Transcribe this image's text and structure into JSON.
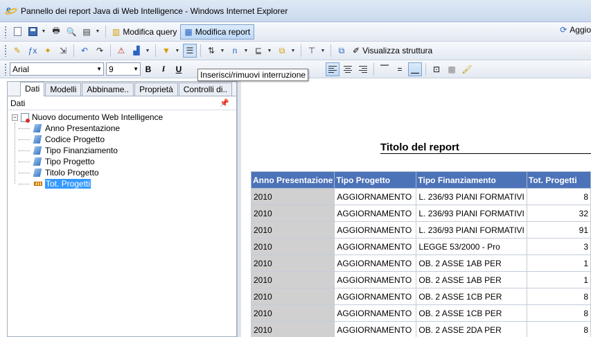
{
  "window": {
    "title": "Pannello dei report Java di Web Intelligence - Windows Internet Explorer"
  },
  "toolbar1": {
    "modifica_query": "Modifica query",
    "modifica_report": "Modifica report",
    "right_label": "Aggio"
  },
  "toolbar2": {
    "visualizza_struttura": "Visualizza struttura"
  },
  "format": {
    "font": "Arial",
    "size": "9",
    "bold": "B",
    "italic": "I",
    "underline": "U"
  },
  "tooltip": "Inserisci/rimuovi interruzione",
  "left_panel": {
    "tabs": [
      "Dati",
      "Modelli",
      "Abbiname..",
      "Proprietà",
      "Controlli di.."
    ],
    "header": "Dati",
    "tree_root": "Nuovo documento Web Intelligence",
    "tree_items": [
      {
        "label": "Anno Presentazione",
        "type": "dimension"
      },
      {
        "label": "Codice Progetto",
        "type": "dimension"
      },
      {
        "label": "Tipo Finanziamento",
        "type": "dimension"
      },
      {
        "label": "Tipo Progetto",
        "type": "dimension"
      },
      {
        "label": "Titolo Progetto",
        "type": "dimension"
      },
      {
        "label": "Tot. Progetti",
        "type": "measure"
      }
    ]
  },
  "report": {
    "title": "Titolo del report",
    "columns": [
      "Anno Presentazione",
      "Tipo Progetto",
      "Tipo Finanziamento",
      "Tot. Progetti"
    ],
    "rows": [
      [
        "2010",
        "AGGIORNAMENTO",
        "L. 236/93 PIANI FORMATIVI",
        "8"
      ],
      [
        "2010",
        "AGGIORNAMENTO",
        "L. 236/93 PIANI FORMATIVI",
        "32"
      ],
      [
        "2010",
        "AGGIORNAMENTO",
        "L. 236/93 PIANI FORMATIVI",
        "91"
      ],
      [
        "2010",
        "AGGIORNAMENTO",
        "LEGGE 53/2000 - Pro",
        "3"
      ],
      [
        "2010",
        "AGGIORNAMENTO",
        "OB. 2 ASSE 1AB PER",
        "1"
      ],
      [
        "2010",
        "AGGIORNAMENTO",
        "OB. 2 ASSE 1AB PER",
        "1"
      ],
      [
        "2010",
        "AGGIORNAMENTO",
        "OB. 2 ASSE 1CB PER",
        "8"
      ],
      [
        "2010",
        "AGGIORNAMENTO",
        "OB. 2 ASSE 1CB PER",
        "8"
      ],
      [
        "2010",
        "AGGIORNAMENTO",
        "OB. 2 ASSE 2DA PER",
        "8"
      ]
    ]
  }
}
